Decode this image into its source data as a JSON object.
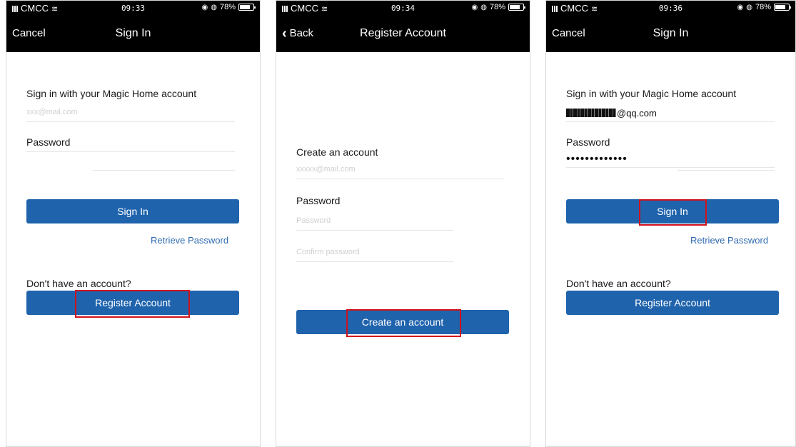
{
  "screens": [
    {
      "status": {
        "carrier": "CMCC",
        "time": "09:33",
        "battery": "78%"
      },
      "nav": {
        "left": "Cancel",
        "title": "Sign In"
      },
      "heading": "Sign in with your Magic Home account",
      "email_placeholder": "xxx@mail.com",
      "password_label": "Password",
      "sign_in_button": "Sign In",
      "retrieve_link": "Retrieve Password",
      "no_account_text": "Don't have an account?",
      "register_button": "Register Account"
    },
    {
      "status": {
        "carrier": "CMCC",
        "time": "09:34",
        "battery": "78%"
      },
      "nav": {
        "left": "Back",
        "title": "Register Account"
      },
      "heading": "Create an account",
      "email_placeholder": "xxxxx@mail.com",
      "password_label": "Password",
      "password_placeholder": "Password",
      "confirm_placeholder": "Confirm password",
      "create_button": "Create an account"
    },
    {
      "status": {
        "carrier": "CMCC",
        "time": "09:36",
        "battery": "78%"
      },
      "nav": {
        "left": "Cancel",
        "title": "Sign In"
      },
      "heading": "Sign in with your Magic Home account",
      "email_value": "@qq.com",
      "password_label": "Password",
      "password_value": "•••••••••••••",
      "sign_in_button": "Sign In",
      "retrieve_link": "Retrieve Password",
      "no_account_text": "Don't have an account?",
      "register_button": "Register Account"
    }
  ],
  "colors": {
    "accent": "#1f63ad",
    "highlight": "#d0121b",
    "link": "#2f6bb0",
    "bar": "#000000"
  },
  "icons": {
    "signal": "signal-bars-icon",
    "wifi": "wifi-icon",
    "back": "chevron-left-icon",
    "battery": "battery-icon",
    "lock": "orientation-lock-icon",
    "alarm": "alarm-icon"
  }
}
